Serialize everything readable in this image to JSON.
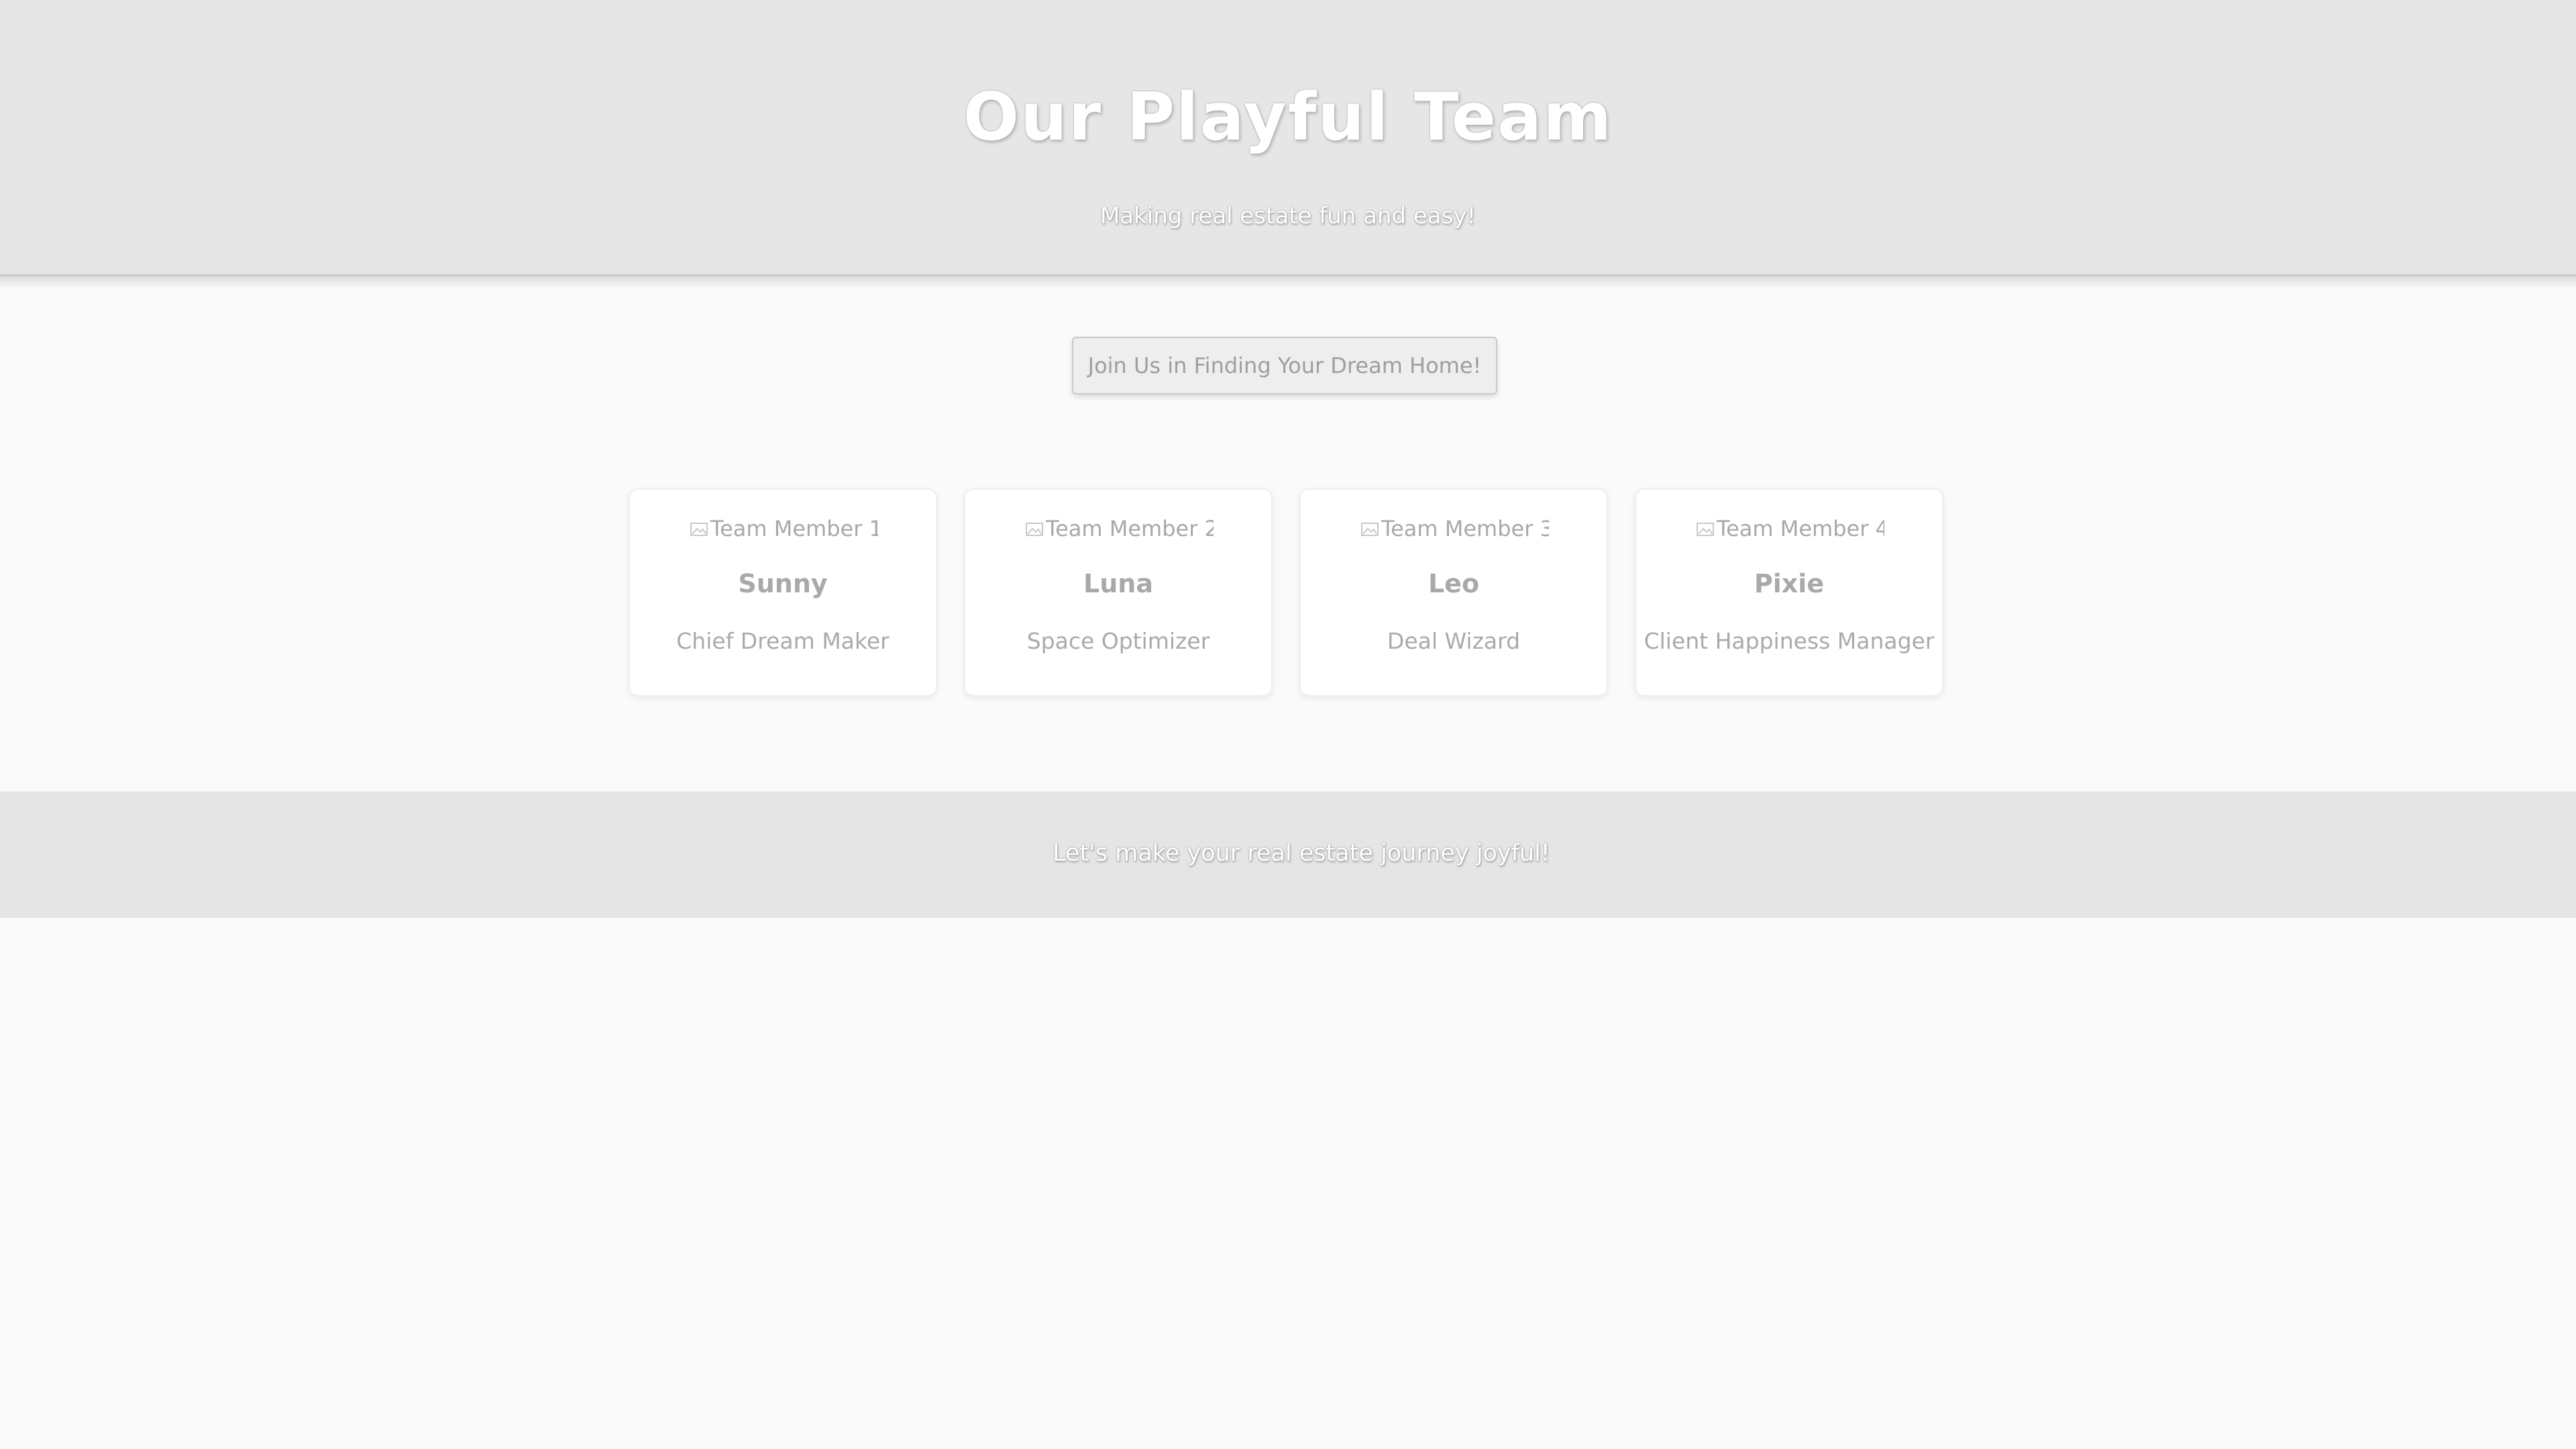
{
  "header": {
    "title": "Our Playful Team",
    "subtitle": "Making real estate fun and easy!"
  },
  "cta": {
    "label": "Join Us in Finding Your Dream Home!"
  },
  "team": [
    {
      "photo_alt": "Team Member 1",
      "name": "Sunny",
      "role": "Chief Dream Maker"
    },
    {
      "photo_alt": "Team Member 2",
      "name": "Luna",
      "role": "Space Optimizer"
    },
    {
      "photo_alt": "Team Member 3",
      "name": "Leo",
      "role": "Deal Wizard"
    },
    {
      "photo_alt": "Team Member 4",
      "name": "Pixie",
      "role": "Client Happiness Manager"
    }
  ],
  "footer": {
    "text": "Let's make your real estate journey joyful!"
  },
  "colors": {
    "header_bg": "#e6e6e6",
    "page_bg": "#fafafa",
    "card_bg": "#ffffff",
    "muted_text": "#a9a9a9"
  },
  "icons": {
    "card_photo": "broken-image-icon"
  }
}
